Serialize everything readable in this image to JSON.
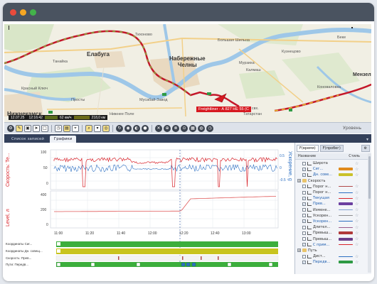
{
  "window": {
    "traffic_lights": [
      "#e94b3c",
      "#f5a623",
      "#43b34a"
    ]
  },
  "map": {
    "cities": [
      {
        "name": "Елабуга",
        "cls": "city"
      },
      {
        "name": "Набережные\nЧелны",
        "cls": "city"
      },
      {
        "name": "Нижнекамск",
        "cls": "city"
      },
      {
        "name": "Мензел",
        "cls": "mid"
      }
    ],
    "labels": [
      "Тихоново",
      "Большая Шильна",
      "Мурзиха",
      "Танайка",
      "Красный Ключ",
      "Просты",
      "Калмаш",
      "Кузнецово",
      "Коноваловка",
      "Беке",
      "Татарстан",
      "пос. свх.",
      "Нижнее Поле",
      "Мусабай-Завод"
    ],
    "vehicle_label": "Freightliner - А 827 НЕ 55 (С",
    "status_bar": [
      "12.07.25",
      "12:16:42",
      "62 км/ч",
      "218,0 км"
    ],
    "zoom_label": "Уровень"
  },
  "toolbar": {
    "icons": [
      "settings-icon",
      "paint-icon",
      "car-icon",
      "arrow-icon",
      "square-icon",
      "clock-icon",
      "film-icon",
      "location-icon",
      "search-icon",
      "zoom-icon",
      "target-icon",
      "refresh-icon",
      "globe-icon",
      "layers-icon",
      "stop-icon",
      "play-icon",
      "record-icon"
    ],
    "dropdown": "Уровень"
  },
  "tabs": [
    {
      "label": "Список записей",
      "active": false
    },
    {
      "label": "Графики",
      "active": true
    }
  ],
  "chart": {
    "y1_label": "Скорость: Те...",
    "y2_label": "Level, л",
    "y1_right_label": "Ускорение, g",
    "y1_ticks": [
      "100",
      "50",
      "0"
    ],
    "y1_right_ticks": [
      "0.5",
      "0",
      "-0.5"
    ],
    "y2_ticks": [
      "400",
      "200",
      "0"
    ],
    "time_ticks": [
      "11:00",
      "11:20",
      "11:40",
      "12:00",
      "12:20",
      "12:40",
      "13:00"
    ],
    "row_labels": [
      "Координаты Сиг...",
      "Координаты Дн. совещ...",
      "Скорость: Прев...",
      "Пути: Передв..."
    ]
  },
  "sidebar": {
    "tabs": [
      {
        "label": "F(время)",
        "active": true
      },
      {
        "label": "F(пробег)",
        "active": false
      }
    ],
    "header": {
      "name": "Название",
      "style": "Стиль"
    },
    "items": [
      {
        "kind": "item",
        "label": "Широта",
        "checked": false,
        "color": ""
      },
      {
        "kind": "item",
        "label": "Сиг...",
        "checked": true,
        "color": "#e08a1c",
        "blue": true
      },
      {
        "kind": "item",
        "label": "Дн. сове...",
        "checked": true,
        "color": "#c9c12a",
        "blue": true
      },
      {
        "kind": "group",
        "label": "Скорость"
      },
      {
        "kind": "item",
        "label": "Порог н...",
        "checked": false,
        "color": "#b04848",
        "line": true
      },
      {
        "kind": "item",
        "label": "Порог н...",
        "checked": false,
        "color": "#2c6fc2",
        "line": true
      },
      {
        "kind": "item",
        "label": "Текущая",
        "checked": true,
        "color": "#d8232a",
        "line": true,
        "blue": true
      },
      {
        "kind": "item",
        "label": "Прев...",
        "checked": true,
        "color": "#6b3fa0",
        "blue": true
      },
      {
        "kind": "item",
        "label": "Измене...",
        "checked": false,
        "color": "#7fa0d0",
        "line": true
      },
      {
        "kind": "item",
        "label": "Ускорен...",
        "checked": false,
        "color": "#8c8c8c",
        "line": true
      },
      {
        "kind": "item",
        "label": "Ускорен...",
        "checked": true,
        "color": "#2c6fc2",
        "line": true,
        "blue": true
      },
      {
        "kind": "item",
        "label": "Длител...",
        "checked": false,
        "color": "#9c5a8a",
        "line": true
      },
      {
        "kind": "item",
        "label": "Превыш...",
        "checked": false,
        "color": "#b03a3a"
      },
      {
        "kind": "item",
        "label": "Превыш...",
        "checked": false,
        "color": "#6b3f8a"
      },
      {
        "kind": "item",
        "label": "С прим...",
        "checked": true,
        "color": "#d8232a",
        "line": true,
        "blue": true
      },
      {
        "kind": "group",
        "label": "Путь"
      },
      {
        "kind": "item",
        "label": "Дист...",
        "checked": false,
        "color": "#2c6fc2",
        "line": true
      },
      {
        "kind": "item",
        "label": "Передв...",
        "checked": true,
        "color": "#2e9a44",
        "blue": true
      }
    ]
  }
}
